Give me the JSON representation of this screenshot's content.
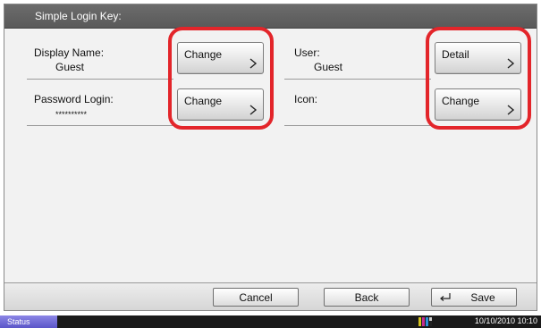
{
  "window": {
    "title": "Simple Login Key:"
  },
  "fields": {
    "display_name": {
      "label": "Display Name:",
      "value": "Guest",
      "button": "Change"
    },
    "password_login": {
      "label": "Password Login:",
      "value": "**********",
      "button": "Change"
    },
    "user": {
      "label": "User:",
      "value": "Guest",
      "button": "Detail"
    },
    "icon": {
      "label": "Icon:",
      "button": "Change"
    }
  },
  "footer": {
    "cancel": "Cancel",
    "back": "Back",
    "save": "Save"
  },
  "statusbar": {
    "status": "Status",
    "datetime": "10/10/2010  10:10"
  },
  "colors": {
    "highlight": "#e3252a",
    "status_accent": "#6b66d6"
  }
}
